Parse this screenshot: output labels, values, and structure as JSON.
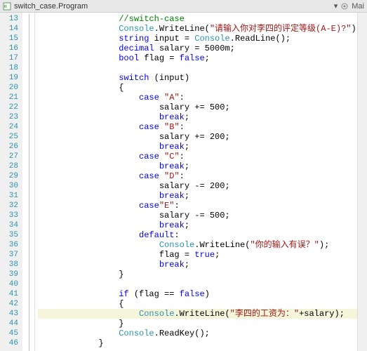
{
  "tab": {
    "title": "switch_case.Program",
    "right_label": "Mai"
  },
  "gutter": {
    "start": 13,
    "end": 46
  },
  "code": {
    "lines": [
      {
        "indent": 16,
        "segs": [
          {
            "t": "//switch-case",
            "c": "cmt"
          }
        ]
      },
      {
        "indent": 16,
        "segs": [
          {
            "t": "Console",
            "c": "type"
          },
          {
            "t": ".WriteLine("
          },
          {
            "t": "\"请输入你对李四的评定等级(A-E)?\"",
            "c": "str"
          },
          {
            "t": ");"
          }
        ]
      },
      {
        "indent": 16,
        "segs": [
          {
            "t": "string",
            "c": "kw"
          },
          {
            "t": " input = "
          },
          {
            "t": "Console",
            "c": "type"
          },
          {
            "t": ".ReadLine();"
          }
        ]
      },
      {
        "indent": 16,
        "segs": [
          {
            "t": "decimal",
            "c": "kw"
          },
          {
            "t": " salary = 5000m;"
          }
        ]
      },
      {
        "indent": 16,
        "segs": [
          {
            "t": "bool",
            "c": "kw"
          },
          {
            "t": " flag = "
          },
          {
            "t": "false",
            "c": "kw"
          },
          {
            "t": ";"
          }
        ]
      },
      {
        "indent": 16,
        "segs": []
      },
      {
        "indent": 16,
        "segs": [
          {
            "t": "switch",
            "c": "kw"
          },
          {
            "t": " (input)"
          }
        ]
      },
      {
        "indent": 16,
        "segs": [
          {
            "t": "{"
          }
        ]
      },
      {
        "indent": 20,
        "segs": [
          {
            "t": "case",
            "c": "kw"
          },
          {
            "t": " "
          },
          {
            "t": "\"A\"",
            "c": "str"
          },
          {
            "t": ":"
          }
        ]
      },
      {
        "indent": 24,
        "segs": [
          {
            "t": "salary += 500;"
          }
        ]
      },
      {
        "indent": 24,
        "segs": [
          {
            "t": "break",
            "c": "kw"
          },
          {
            "t": ";"
          }
        ]
      },
      {
        "indent": 20,
        "segs": [
          {
            "t": "case",
            "c": "kw"
          },
          {
            "t": " "
          },
          {
            "t": "\"B\"",
            "c": "str"
          },
          {
            "t": ":"
          }
        ]
      },
      {
        "indent": 24,
        "segs": [
          {
            "t": "salary += 200;"
          }
        ]
      },
      {
        "indent": 24,
        "segs": [
          {
            "t": "break",
            "c": "kw"
          },
          {
            "t": ";"
          }
        ]
      },
      {
        "indent": 20,
        "segs": [
          {
            "t": "case",
            "c": "kw"
          },
          {
            "t": " "
          },
          {
            "t": "\"C\"",
            "c": "str"
          },
          {
            "t": ":"
          }
        ]
      },
      {
        "indent": 24,
        "segs": [
          {
            "t": "break",
            "c": "kw"
          },
          {
            "t": ";"
          }
        ]
      },
      {
        "indent": 20,
        "segs": [
          {
            "t": "case",
            "c": "kw"
          },
          {
            "t": " "
          },
          {
            "t": "\"D\"",
            "c": "str"
          },
          {
            "t": ":"
          }
        ]
      },
      {
        "indent": 24,
        "segs": [
          {
            "t": "salary -= 200;"
          }
        ]
      },
      {
        "indent": 24,
        "segs": [
          {
            "t": "break",
            "c": "kw"
          },
          {
            "t": ";"
          }
        ]
      },
      {
        "indent": 20,
        "segs": [
          {
            "t": "case",
            "c": "kw"
          },
          {
            "t": "\"E\"",
            "c": "str"
          },
          {
            "t": ":"
          }
        ]
      },
      {
        "indent": 24,
        "segs": [
          {
            "t": "salary -= 500;"
          }
        ]
      },
      {
        "indent": 24,
        "segs": [
          {
            "t": "break",
            "c": "kw"
          },
          {
            "t": ";"
          }
        ]
      },
      {
        "indent": 20,
        "segs": [
          {
            "t": "default",
            "c": "kw"
          },
          {
            "t": ":"
          }
        ]
      },
      {
        "indent": 24,
        "segs": [
          {
            "t": "Console",
            "c": "type"
          },
          {
            "t": ".WriteLine("
          },
          {
            "t": "\"你的输入有误？\"",
            "c": "str"
          },
          {
            "t": ");"
          }
        ]
      },
      {
        "indent": 24,
        "segs": [
          {
            "t": "flag = "
          },
          {
            "t": "true",
            "c": "kw"
          },
          {
            "t": ";"
          }
        ]
      },
      {
        "indent": 24,
        "segs": [
          {
            "t": "break",
            "c": "kw"
          },
          {
            "t": ";"
          }
        ]
      },
      {
        "indent": 16,
        "segs": [
          {
            "t": "}"
          }
        ]
      },
      {
        "indent": 16,
        "segs": []
      },
      {
        "indent": 16,
        "segs": [
          {
            "t": "if",
            "c": "kw"
          },
          {
            "t": " (flag == "
          },
          {
            "t": "false",
            "c": "kw"
          },
          {
            "t": ")"
          }
        ]
      },
      {
        "indent": 16,
        "segs": [
          {
            "t": "{"
          }
        ]
      },
      {
        "indent": 20,
        "hl": true,
        "segs": [
          {
            "t": "Console",
            "c": "type"
          },
          {
            "t": ".WriteLine("
          },
          {
            "t": "\"李四的工资为：\"",
            "c": "str"
          },
          {
            "t": "+salary);"
          }
        ]
      },
      {
        "indent": 16,
        "segs": [
          {
            "t": "}"
          }
        ]
      },
      {
        "indent": 16,
        "segs": [
          {
            "t": "Console",
            "c": "type"
          },
          {
            "t": ".ReadKey();"
          }
        ]
      },
      {
        "indent": 12,
        "segs": [
          {
            "t": "}"
          }
        ]
      }
    ]
  }
}
